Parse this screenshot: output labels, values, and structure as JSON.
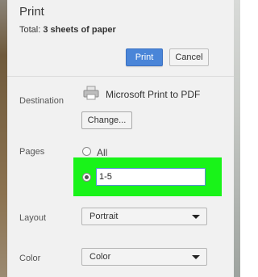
{
  "dialog": {
    "title": "Print",
    "total_prefix": "Total: ",
    "total_value": "3 sheets of paper",
    "print_label": "Print",
    "cancel_label": "Cancel"
  },
  "destination": {
    "label": "Destination",
    "printer_name": "Microsoft Print to PDF",
    "change_label": "Change..."
  },
  "pages": {
    "label": "Pages",
    "all_label": "All",
    "custom_value": "1-5"
  },
  "layout": {
    "label": "Layout",
    "selected": "Portrait"
  },
  "color": {
    "label": "Color",
    "selected": "Color"
  },
  "colors": {
    "primary_button": "#4a85d8",
    "highlight": "#19f319"
  },
  "icons": {
    "printer": "printer-icon",
    "dropdown": "chevron-down-icon"
  }
}
